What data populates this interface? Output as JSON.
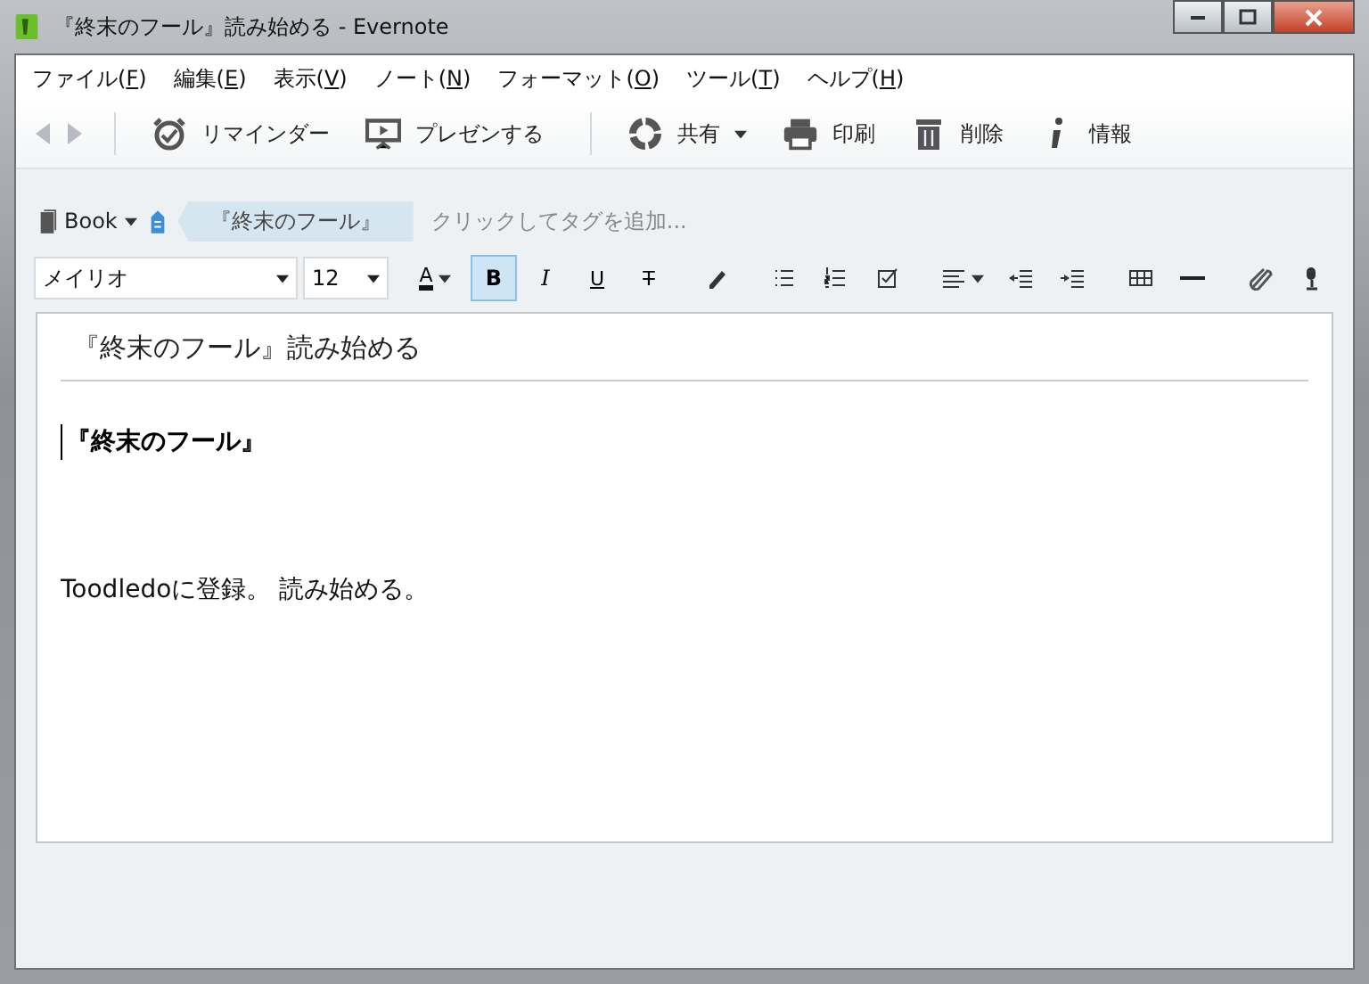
{
  "window": {
    "title": "『終末のフール』読み始める - Evernote"
  },
  "menu": [
    {
      "before": "ファイル(",
      "key": "F",
      "after": ")"
    },
    {
      "before": "編集(",
      "key": "E",
      "after": ")"
    },
    {
      "before": "表示(",
      "key": "V",
      "after": ")"
    },
    {
      "before": "ノート(",
      "key": "N",
      "after": ")"
    },
    {
      "before": "フォーマット(",
      "key": "O",
      "after": ")"
    },
    {
      "before": "ツール(",
      "key": "T",
      "after": ")"
    },
    {
      "before": "ヘルプ(",
      "key": "H",
      "after": ")"
    }
  ],
  "toolbar": [
    {
      "kind": "reminder",
      "label": "リマインダー"
    },
    {
      "kind": "present",
      "label": "プレゼンする"
    },
    {
      "kind": "share",
      "label": "共有"
    },
    {
      "kind": "print",
      "label": "印刷"
    },
    {
      "kind": "delete",
      "label": "削除"
    },
    {
      "kind": "info",
      "label": "情報"
    }
  ],
  "notebook": {
    "name": "Book"
  },
  "tags": [
    {
      "label": "『終末のフール』"
    }
  ],
  "tag_placeholder": "クリックしてタグを追加...",
  "font": {
    "family": "メイリオ",
    "size": "12"
  },
  "format_tools": [
    {
      "kind": "color",
      "label": "A",
      "selected": false
    },
    {
      "kind": "bold",
      "label": "B",
      "selected": true
    },
    {
      "kind": "italic",
      "label": "I",
      "selected": false
    },
    {
      "kind": "underline",
      "label": "U",
      "selected": false
    },
    {
      "kind": "strike",
      "label": "T",
      "selected": false
    },
    {
      "kind": "highlight",
      "selected": false
    },
    {
      "kind": "bullets",
      "selected": false
    },
    {
      "kind": "numbers",
      "selected": false
    },
    {
      "kind": "todo",
      "selected": false
    },
    {
      "kind": "align",
      "selected": false
    },
    {
      "kind": "outdent",
      "selected": false
    },
    {
      "kind": "indent",
      "selected": false
    },
    {
      "kind": "table",
      "selected": false
    },
    {
      "kind": "rule",
      "selected": false
    },
    {
      "kind": "attach",
      "selected": false
    },
    {
      "kind": "mic",
      "selected": false
    }
  ],
  "note": {
    "title": "『終末のフール』読み始める",
    "paragraphs": [
      {
        "kind": "heading",
        "text": "『終末のフール』"
      },
      {
        "kind": "body",
        "text": "Toodledoに登録。 読み始める。"
      }
    ]
  }
}
